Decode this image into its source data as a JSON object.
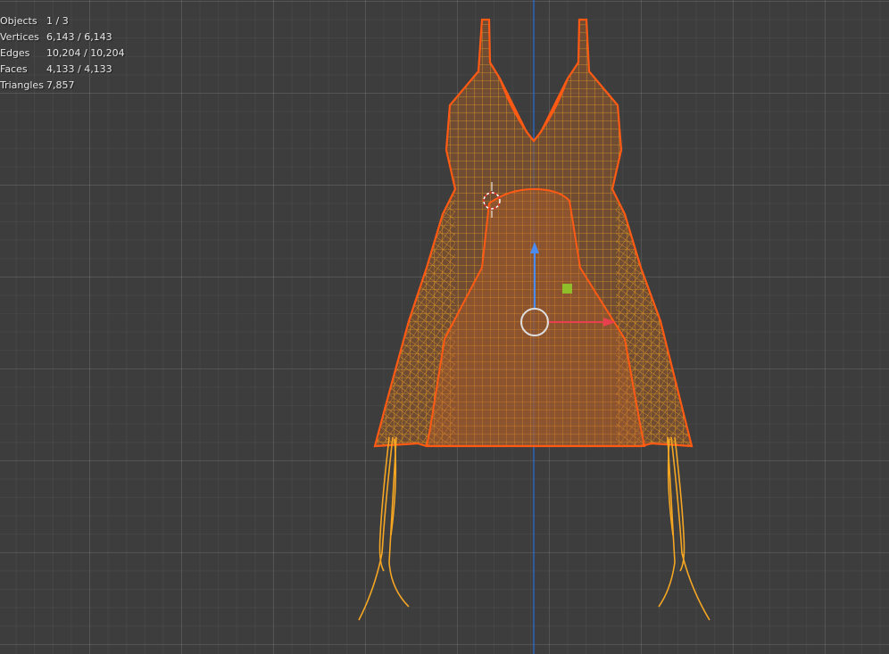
{
  "stats": {
    "rows": [
      {
        "label": "Objects",
        "value": "1 / 3"
      },
      {
        "label": "Vertices",
        "value": "6,143 / 6,143"
      },
      {
        "label": "Edges",
        "value": "10,204 / 10,204"
      },
      {
        "label": "Faces",
        "value": "4,133 / 4,133"
      },
      {
        "label": "Triangles",
        "value": "7,857"
      }
    ]
  },
  "colors": {
    "background": "#3d3d3d",
    "wire": "#f5a623",
    "outline": "#ff5a14",
    "fill": "#9a5a2a",
    "y_axis": "#2a6fd8",
    "gizmo_x": "#e8404f",
    "gizmo_y": "#4a8cf0",
    "gizmo_plane": "#8fcf2a"
  },
  "icons": {
    "cursor": "3d-cursor-icon",
    "origin": "object-origin-icon"
  }
}
